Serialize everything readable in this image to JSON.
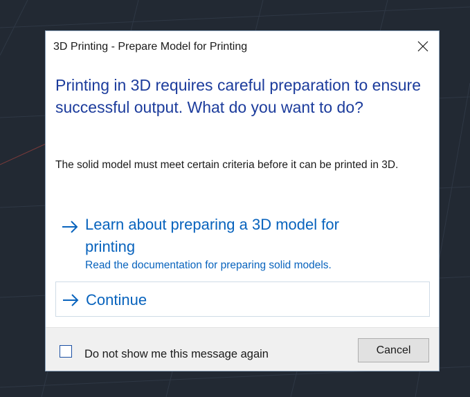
{
  "dialog": {
    "title": "3D Printing - Prepare Model for Printing",
    "main_instruction": "Printing in 3D requires careful preparation to ensure successful output. What do you want to do?",
    "content": "The solid model must meet certain criteria before it can be printed in 3D.",
    "command_links": [
      {
        "title": "Learn about preparing a 3D model for printing",
        "description": "Read the documentation for preparing solid models."
      },
      {
        "title": "Continue"
      }
    ],
    "footer": {
      "checkbox_label": "Do not show me this message again",
      "checkbox_checked": false,
      "cancel_label": "Cancel"
    }
  },
  "icons": {
    "close": "close-icon",
    "arrow": "arrow-right-icon"
  },
  "colors": {
    "background": "#222933",
    "instruction_text": "#1c3c9c",
    "link_text": "#0863bd",
    "footer_bg": "#f0f0f0"
  }
}
